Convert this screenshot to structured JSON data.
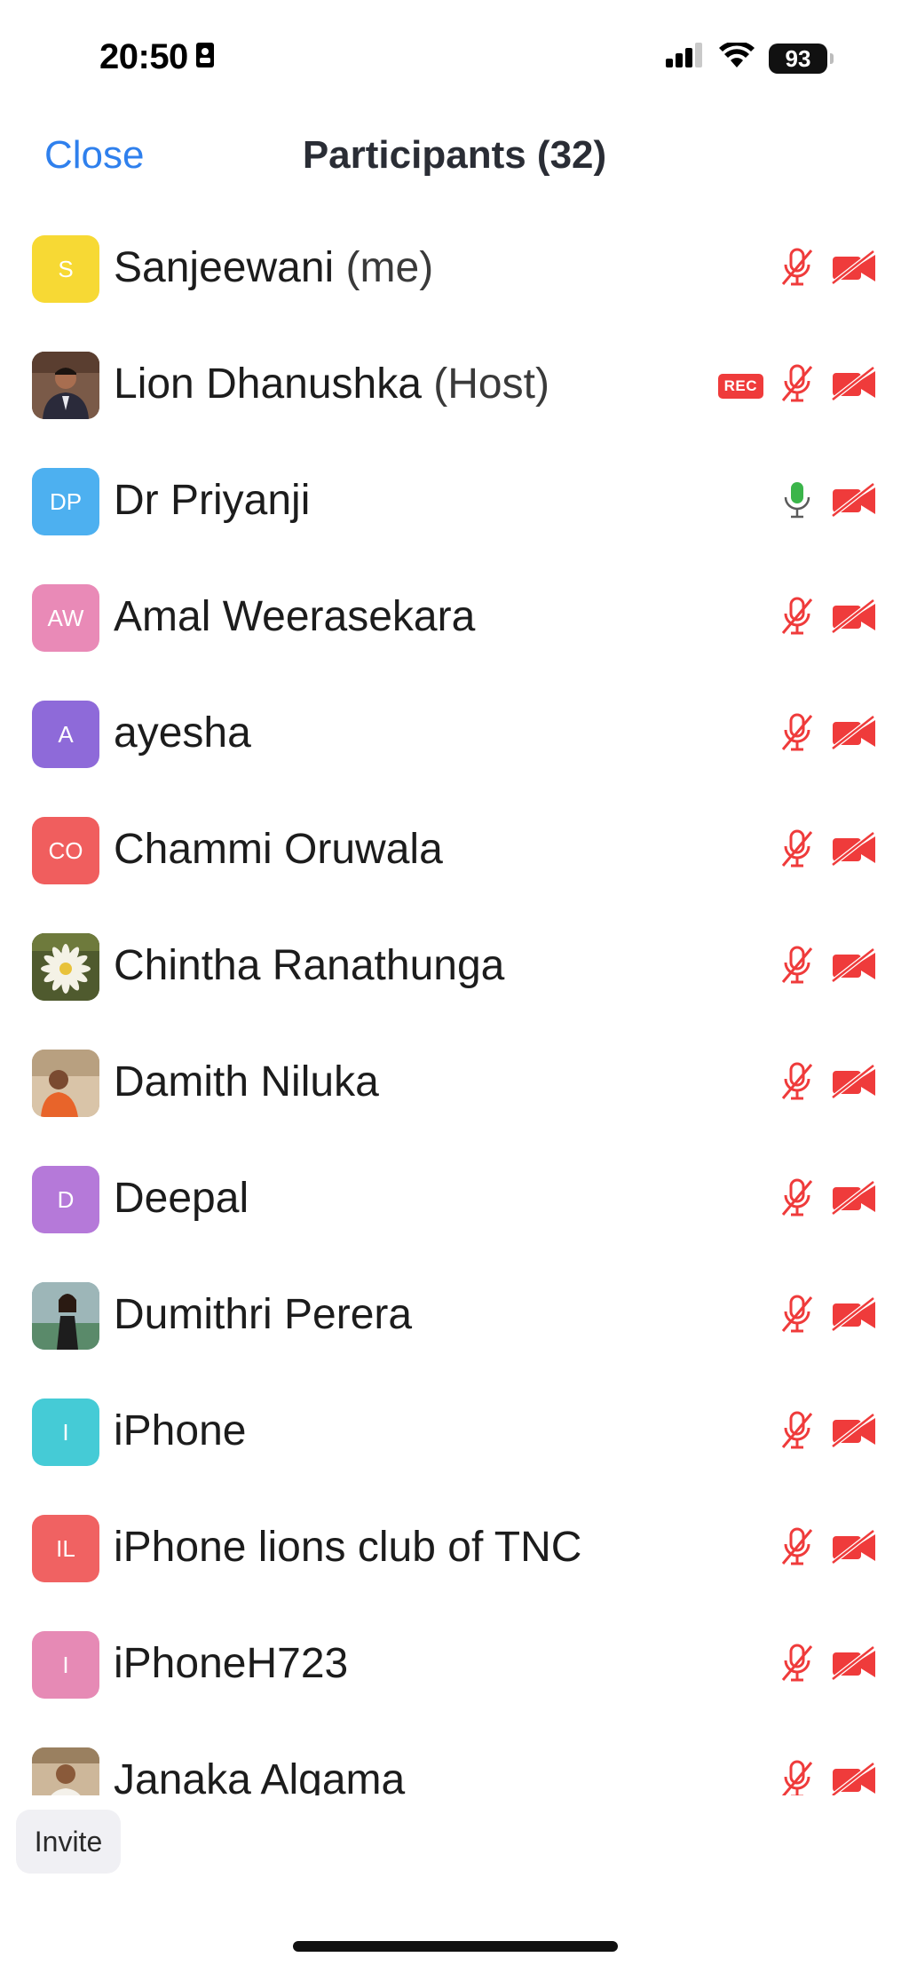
{
  "status_bar": {
    "time": "20:50",
    "battery": "93"
  },
  "header": {
    "close_label": "Close",
    "title": "Participants (32)"
  },
  "participants": [
    {
      "name": "Sanjeewani",
      "suffix": "(me)",
      "initials": "S",
      "avatar_color": "#f7d934",
      "avatar_type": "initials",
      "mic": "muted",
      "video": "off",
      "rec": false
    },
    {
      "name": "Lion Dhanushka",
      "suffix": "(Host)",
      "initials": "",
      "avatar_color": "#6b4a3a",
      "avatar_type": "photo-man",
      "mic": "muted",
      "video": "off",
      "rec": true,
      "rec_label": "REC"
    },
    {
      "name": "Dr Priyanji",
      "suffix": "",
      "initials": "DP",
      "avatar_color": "#4db0f0",
      "avatar_type": "initials",
      "mic": "on",
      "video": "off",
      "rec": false
    },
    {
      "name": "Amal Weerasekara",
      "suffix": "",
      "initials": "AW",
      "avatar_color": "#e98ab7",
      "avatar_type": "initials",
      "mic": "muted",
      "video": "off",
      "rec": false
    },
    {
      "name": "ayesha",
      "suffix": "",
      "initials": "A",
      "avatar_color": "#8e6ad9",
      "avatar_type": "initials",
      "mic": "muted",
      "video": "off",
      "rec": false
    },
    {
      "name": "Chammi Oruwala",
      "suffix": "",
      "initials": "CO",
      "avatar_color": "#f05e5e",
      "avatar_type": "initials",
      "mic": "muted",
      "video": "off",
      "rec": false
    },
    {
      "name": "Chintha Ranathunga",
      "suffix": "",
      "initials": "",
      "avatar_color": "#5f6b3a",
      "avatar_type": "photo-flower",
      "mic": "muted",
      "video": "off",
      "rec": false
    },
    {
      "name": "Damith Niluka",
      "suffix": "",
      "initials": "",
      "avatar_color": "#c9a27a",
      "avatar_type": "photo-man-orange",
      "mic": "muted",
      "video": "off",
      "rec": false
    },
    {
      "name": "Deepal",
      "suffix": "",
      "initials": "D",
      "avatar_color": "#b579d9",
      "avatar_type": "initials",
      "mic": "muted",
      "video": "off",
      "rec": false
    },
    {
      "name": "Dumithri Perera",
      "suffix": "",
      "initials": "",
      "avatar_color": "#7aa0b0",
      "avatar_type": "photo-woman",
      "mic": "muted",
      "video": "off",
      "rec": false
    },
    {
      "name": "iPhone",
      "suffix": "",
      "initials": "I",
      "avatar_color": "#45cbd6",
      "avatar_type": "initials",
      "mic": "muted",
      "video": "off",
      "rec": false
    },
    {
      "name": "iPhone lions club of TNC",
      "suffix": "",
      "initials": "IL",
      "avatar_color": "#f06262",
      "avatar_type": "initials",
      "mic": "muted",
      "video": "off",
      "rec": false
    },
    {
      "name": "iPhoneH723",
      "suffix": "",
      "initials": "I",
      "avatar_color": "#e68ab5",
      "avatar_type": "initials",
      "mic": "muted",
      "video": "off",
      "rec": false
    },
    {
      "name": "Janaka Algama",
      "suffix": "",
      "initials": "",
      "avatar_color": "#d8c8b0",
      "avatar_type": "photo-man-white",
      "mic": "muted",
      "video": "off",
      "rec": false
    }
  ],
  "footer": {
    "invite_label": "Invite"
  },
  "colors": {
    "accent": "#2f80ed",
    "muted_red": "#ef3b3b",
    "mic_on_green": "#3bb54a"
  }
}
